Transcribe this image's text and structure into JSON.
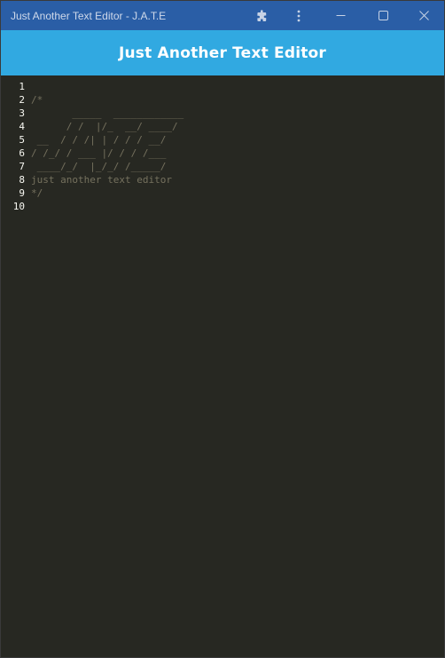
{
  "window": {
    "title": "Just Another Text Editor - J.A.T.E"
  },
  "header": {
    "title": "Just Another Text Editor"
  },
  "editor": {
    "line_numbers": [
      "1",
      "2",
      "3",
      "4",
      "5",
      "6",
      "7",
      "8",
      "9",
      "10"
    ],
    "lines": [
      "",
      "/*",
      "       _____  ____________",
      "      / /  |/_  __/ ____/",
      " __  / / /| | / / / __/",
      "/ /_/ / ___ |/ / / /___",
      " ____/_/  |_/_/ /_____/",
      "just another text editor",
      "*/",
      ""
    ]
  },
  "colors": {
    "titlebar": "#2a5ea6",
    "header": "#31a9e1",
    "editor_bg": "#272822",
    "comment": "#75715e",
    "line_number": "#f8f8f2"
  },
  "icons": [
    "extensions-icon",
    "more-menu-icon",
    "minimize-icon",
    "maximize-icon",
    "close-icon"
  ]
}
